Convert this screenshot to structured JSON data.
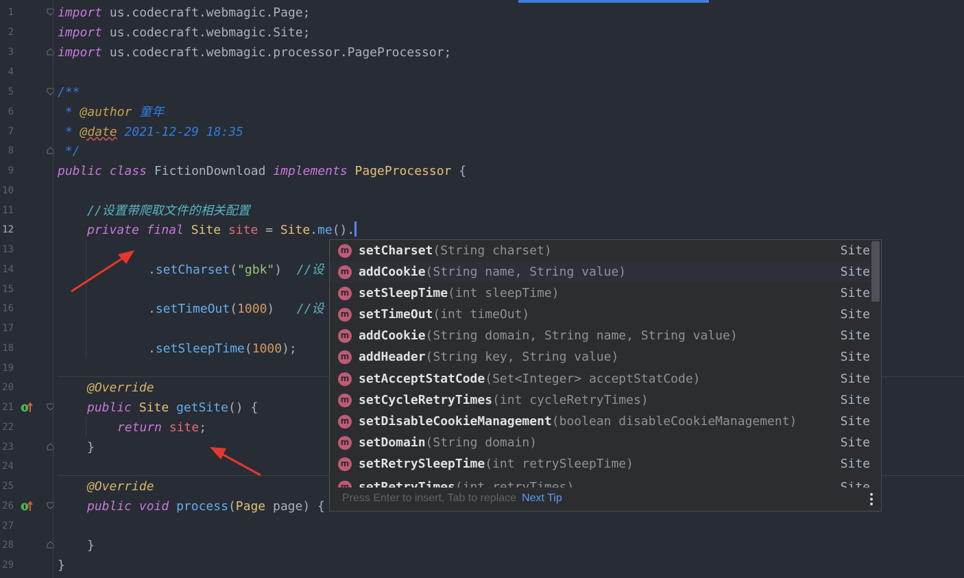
{
  "editor": {
    "line_numbers": [
      "1",
      "2",
      "3",
      "4",
      "5",
      "6",
      "7",
      "8",
      "9",
      "10",
      "11",
      "12",
      "13",
      "14",
      "15",
      "16",
      "17",
      "18",
      "19",
      "20",
      "21",
      "22",
      "23",
      "24",
      "25",
      "26",
      "27",
      "28",
      "29"
    ],
    "current_line": "12",
    "code": {
      "l1_kw": "import",
      "l1_rest": " us.codecraft.webmagic.Page;",
      "l2_kw": "import",
      "l2_rest": " us.codecraft.webmagic.Site;",
      "l3_kw": "import",
      "l3_rest": " us.codecraft.webmagic.processor.PageProcessor;",
      "l5_doc": "/**",
      "l6_star": " * ",
      "l6_tag": "@author",
      "l6_val": " 童年",
      "l7_star": " * ",
      "l7_tag": "@date",
      "l7_val": " 2021-12-29 18:35",
      "l8_doc": " */",
      "l9_kw1": "public",
      "l9_kw2": "class",
      "l9_name": "FictionDownload",
      "l9_kw3": "implements",
      "l9_type": "PageProcessor",
      "l9_brace": " {",
      "l11_comment": "//设置带爬取文件的相关配置",
      "l12_kw1": "private",
      "l12_kw2": "final",
      "l12_type": "Site",
      "l12_field": "site",
      "l12_eq": " = ",
      "l12_cls": "Site",
      "l12_dot": ".",
      "l12_fn": "me",
      "l12_tail": "().",
      "l14_dot": ".",
      "l14_fn": "setCharset",
      "l14_open": "(",
      "l14_str": "\"gbk\"",
      "l14_close": ")",
      "l14_comment": "//设",
      "l16_dot": ".",
      "l16_fn": "setTimeOut",
      "l16_open": "(",
      "l16_num": "1000",
      "l16_close": ")",
      "l16_comment": "//设",
      "l18_dot": ".",
      "l18_fn": "setSleepTime",
      "l18_open": "(",
      "l18_num": "1000",
      "l18_close": ");",
      "l20_ann": "@Override",
      "l21_kw": "public",
      "l21_type": "Site",
      "l21_fn": "getSite",
      "l21_tail": "() {",
      "l22_kw": "return",
      "l22_field": "site",
      "l22_semi": ";",
      "l23_brace": "}",
      "l25_ann": "@Override",
      "l26_kw1": "public",
      "l26_kw2": "void",
      "l26_fn": "process",
      "l26_open": "(",
      "l26_type": "Page",
      "l26_param": "page",
      "l26_tail": ") {",
      "l28_brace": "}",
      "l29_brace": "}"
    }
  },
  "completion_popup": {
    "items": [
      {
        "name": "setCharset",
        "params": "(String charset)",
        "type": "Site"
      },
      {
        "name": "addCookie",
        "params": "(String name, String value)",
        "type": "Site"
      },
      {
        "name": "setSleepTime",
        "params": "(int sleepTime)",
        "type": "Site"
      },
      {
        "name": "setTimeOut",
        "params": "(int timeOut)",
        "type": "Site"
      },
      {
        "name": "addCookie",
        "params": "(String domain, String name, String value)",
        "type": "Site"
      },
      {
        "name": "addHeader",
        "params": "(String key, String value)",
        "type": "Site"
      },
      {
        "name": "setAcceptStatCode",
        "params": "(Set<Integer> acceptStatCode)",
        "type": "Site"
      },
      {
        "name": "setCycleRetryTimes",
        "params": "(int cycleRetryTimes)",
        "type": "Site"
      },
      {
        "name": "setDisableCookieManagement",
        "params": "(boolean disableCookieManagement)",
        "type": "Site"
      },
      {
        "name": "setDomain",
        "params": "(String domain)",
        "type": "Site"
      },
      {
        "name": "setRetrySleepTime",
        "params": "(int retrySleepTime)",
        "type": "Site"
      },
      {
        "name": "setRetryTimes",
        "params": "(int retryTimes)",
        "type": "Site"
      }
    ],
    "method_icon_letter": "m",
    "hint_text": "Press Enter to insert, Tab to replace",
    "next_tip": "Next Tip"
  },
  "colors": {
    "background": "#282c34",
    "keyword": "#c678dd",
    "type": "#e5c07b",
    "function": "#61afef",
    "string": "#98c379",
    "number": "#d19a66",
    "field": "#e06c75",
    "comment": "#56b6c2",
    "doc": "#2f7de1",
    "annotation_arrows": "#e8372c",
    "method_icon": "#c05a75"
  }
}
